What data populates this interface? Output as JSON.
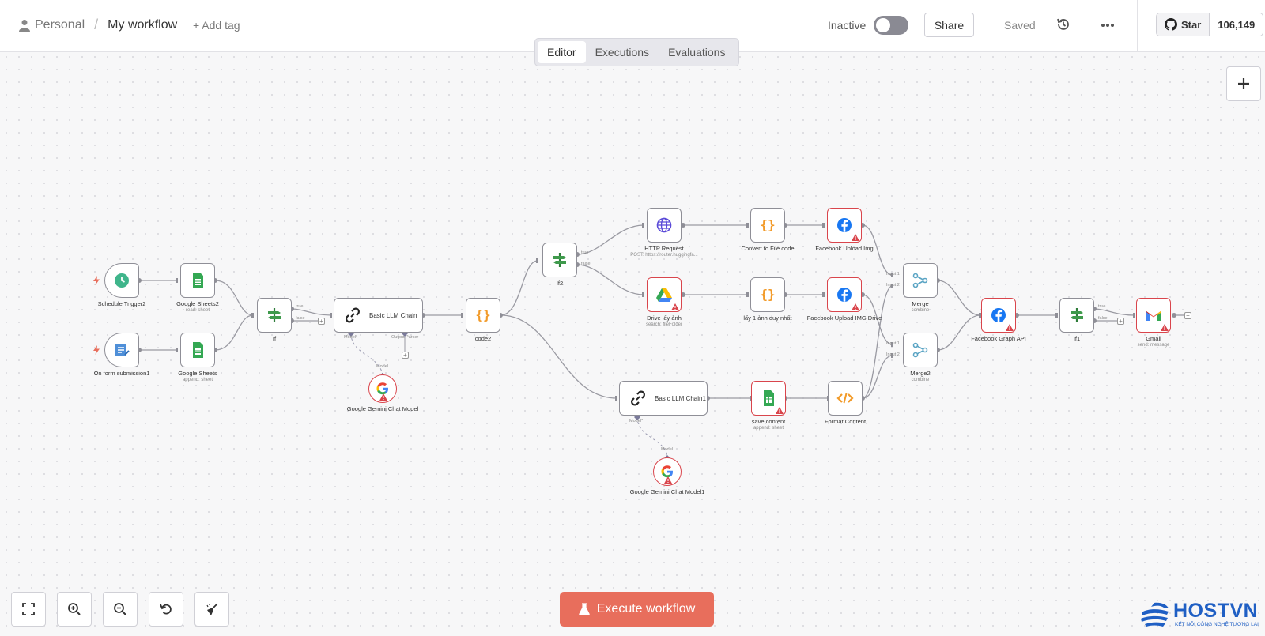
{
  "header": {
    "workspace": "Personal",
    "separator": "/",
    "workflow_name": "My workflow",
    "add_tag": "+ Add tag",
    "status_label": "Inactive",
    "share": "Share",
    "saved": "Saved",
    "github_star": "Star",
    "github_count": "106,149"
  },
  "tabs": [
    "Editor",
    "Executions",
    "Evaluations"
  ],
  "active_tab": "Editor",
  "nodes": {
    "schedule": {
      "label": "Schedule Trigger2"
    },
    "form": {
      "label": "On form submission1"
    },
    "gs2": {
      "label": "Google Sheets2",
      "sub": "read: sheet"
    },
    "gs": {
      "label": "Google Sheets",
      "sub": "append: sheet"
    },
    "if": {
      "label": "If",
      "true": "true",
      "false": "false"
    },
    "llm": {
      "label": "Basic LLM Chain",
      "model_port": "Model*",
      "parser_port": "Output Parser"
    },
    "gemini": {
      "label": "Google Gemini Chat Model",
      "port": "Model"
    },
    "code2": {
      "label": "code2"
    },
    "if2": {
      "label": "If2",
      "true": "true",
      "false": "false"
    },
    "http": {
      "label": "HTTP Request",
      "sub": "POST: https://router.huggingfa..."
    },
    "drive": {
      "label": "Drive lấy ảnh",
      "sub": "search: fileFolder"
    },
    "convert": {
      "label": "Convert to File code"
    },
    "lay1": {
      "label": "lấy 1 ảnh duy nhất"
    },
    "fbimg": {
      "label": "Facebook Upload Img"
    },
    "fbdrive": {
      "label": "Facebook Upload IMG Drive"
    },
    "llm1": {
      "label": "Basic LLM Chain1",
      "model_port": "Model*"
    },
    "gemini1": {
      "label": "Google Gemini Chat Model1",
      "port": "Model"
    },
    "save": {
      "label": "save content",
      "sub": "append: sheet"
    },
    "format": {
      "label": "Format Content"
    },
    "merge": {
      "label": "Merge",
      "sub": "combine",
      "in1": "Input 1",
      "in2": "Input 2"
    },
    "merge2": {
      "label": "Merge2",
      "sub": "combine",
      "in1": "Input 1",
      "in2": "Input 2"
    },
    "fbgraph": {
      "label": "Facebook Graph API"
    },
    "if1": {
      "label": "If1",
      "true": "true",
      "false": "false"
    },
    "gmail": {
      "label": "Gmail",
      "sub": "send: message"
    }
  },
  "execute_button": "Execute workflow",
  "brand": {
    "name": "HOSTVN",
    "tagline": "KẾT NỐI CÔNG NGHỆ TƯƠNG LAI"
  },
  "colors": {
    "accent": "#e86e5c",
    "error": "#d9454c",
    "edge": "#9a9aa2",
    "brand": "#1f5fc4"
  }
}
